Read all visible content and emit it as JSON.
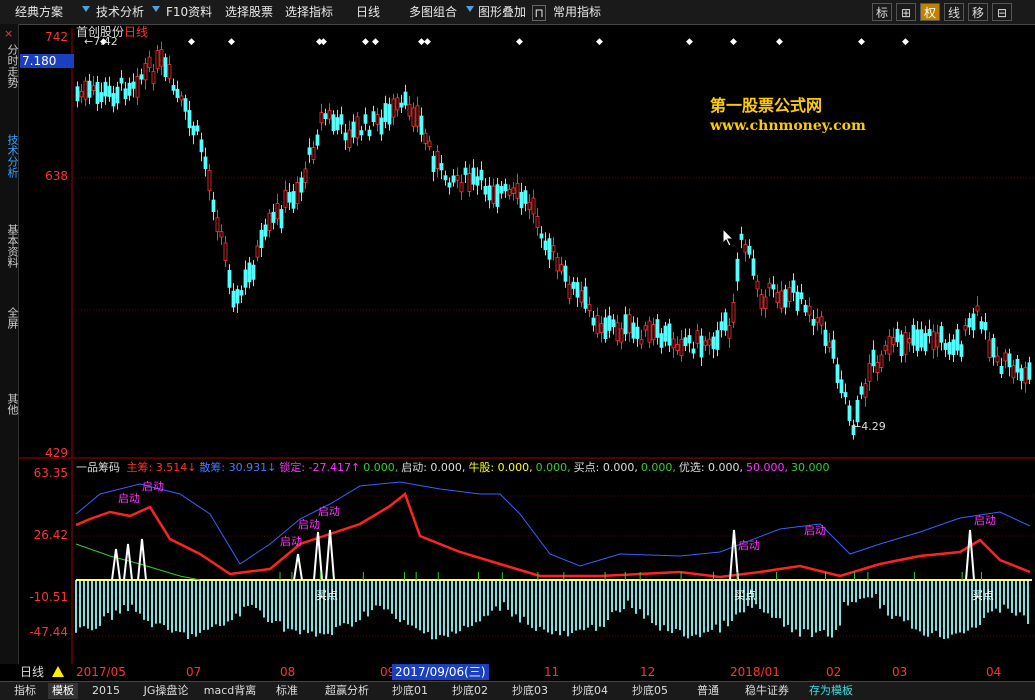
{
  "menu": {
    "items": [
      "经典方案",
      "技术分析",
      "F10资料",
      "选择股票",
      "选择指标",
      "日线",
      "多图组合",
      "图形叠加",
      "常用指标"
    ],
    "right_buttons": [
      "标",
      "⊞",
      "权",
      "线",
      "移",
      "⊟"
    ]
  },
  "side_tabs": [
    "分时走势",
    "技术分析",
    "基本资料",
    "全屏",
    "其他"
  ],
  "main_chart": {
    "stock_name": "首创股份",
    "period": "日线",
    "high_label": "←7.42",
    "low_label": "←4.29",
    "current_price": "7.180",
    "y_labels": [
      "742",
      "638",
      "429"
    ]
  },
  "indicator": {
    "name": "一品筹码",
    "values": [
      {
        "label": "主筹:",
        "value": "3.514↓",
        "color": "#ff3333"
      },
      {
        "label": "散筹:",
        "value": "30.931↓",
        "color": "#4a7aff"
      },
      {
        "label": "锁定:",
        "value": "-27.417↑",
        "color": "#ff33ff"
      },
      {
        "label": "",
        "value": "0.000,",
        "color": "#33cc33"
      },
      {
        "label": "启动:",
        "value": "0.000,",
        "color": "#dddddd"
      },
      {
        "label": "牛股:",
        "value": "0.000,",
        "color": "#ffff00"
      },
      {
        "label": "",
        "value": "0.000,",
        "color": "#33cc33"
      },
      {
        "label": "买点:",
        "value": "0.000,",
        "color": "#dddddd"
      },
      {
        "label": "",
        "value": "0.000,",
        "color": "#33cc33"
      },
      {
        "label": "优选:",
        "value": "0.000,",
        "color": "#dddddd"
      },
      {
        "label": "",
        "value": "50.000,",
        "color": "#ff33ff"
      },
      {
        "label": "",
        "value": "30.000",
        "color": "#33cc33"
      }
    ],
    "y_labels": [
      "63.35",
      "26.42",
      "-10.51",
      "-47.44"
    ],
    "signal_labels": [
      "启动",
      "启动",
      "启动",
      "启动",
      "启动",
      "启动",
      "启动",
      "启动"
    ],
    "buy_labels": [
      "买点",
      "买点",
      "买点"
    ]
  },
  "date_axis": {
    "period": "日线",
    "labels": [
      "2017/05",
      "07",
      "08",
      "09",
      "11",
      "12",
      "2018/01",
      "02",
      "03",
      "04"
    ],
    "selected_date": "2017/09/06(三)"
  },
  "watermark": {
    "title": "第一股票公式网",
    "url": "www.chnmoney.com"
  },
  "bottom_tabs": [
    "指标",
    "模板",
    "2015",
    "JG操盘论",
    "macd背离",
    "标准",
    "超赢分析",
    "抄底01",
    "抄底02",
    "抄底03",
    "抄底04",
    "抄底05",
    "普通",
    "稳牛证券",
    "存为模板"
  ]
}
